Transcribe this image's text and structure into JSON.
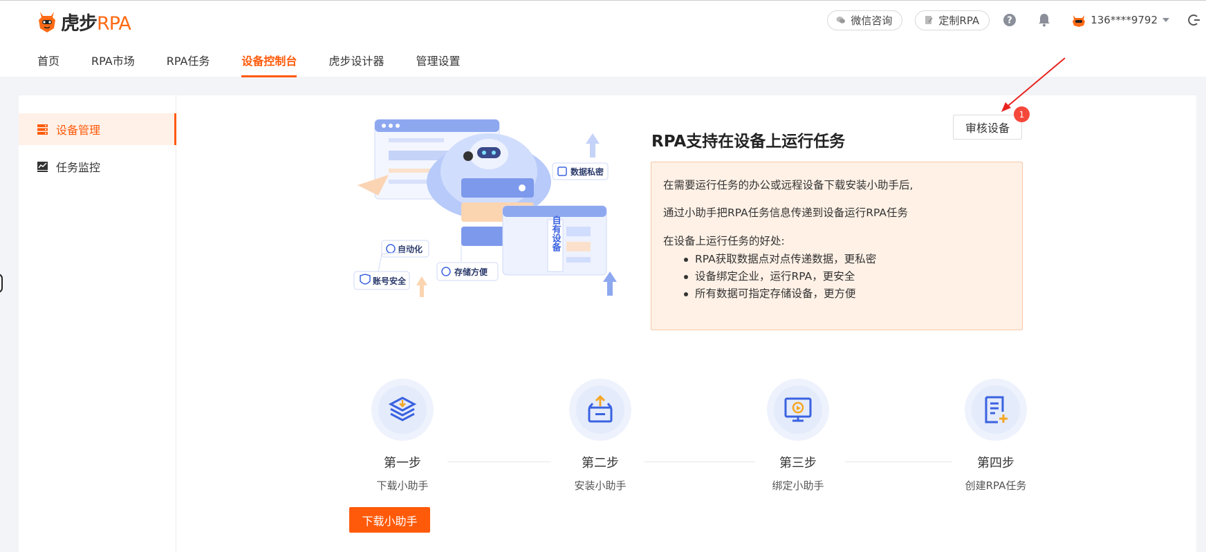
{
  "app": {
    "brand_main": "虎步",
    "brand_accent": "RPA"
  },
  "header": {
    "wechat_label": "微信咨询",
    "custom_label": "定制RPA",
    "user_name": "136****9792"
  },
  "nav": {
    "items": [
      {
        "label": "首页"
      },
      {
        "label": "RPA市场"
      },
      {
        "label": "RPA任务"
      },
      {
        "label": "设备控制台",
        "active": true
      },
      {
        "label": "虎步设计器"
      },
      {
        "label": "管理设置"
      }
    ]
  },
  "sidebar": {
    "items": [
      {
        "label": "设备管理",
        "icon": "server-icon",
        "active": true
      },
      {
        "label": "任务监控",
        "icon": "chart-icon"
      }
    ]
  },
  "main": {
    "headline": "RPA支持在设备上运行任务",
    "audit_button": "审核设备",
    "audit_badge": "1",
    "info": {
      "line1": "在需要运行任务的办公或远程设备下载安装小助手后,",
      "line2": "通过小助手把RPA任务信息传递到设备运行RPA任务",
      "benefits_title": "在设备上运行任务的好处:",
      "benefits": [
        "RPA获取数据点对点传递数据，更私密",
        "设备绑定企业，运行RPA，更安全",
        "所有数据可指定存储设备，更方便"
      ]
    },
    "illustration_labels": {
      "privacy": "数据私密",
      "automation": "自动化",
      "account": "账号安全",
      "storage": "存储方便",
      "own_device": "自有设备"
    },
    "steps": [
      {
        "title": "第一步",
        "desc": "下载小助手",
        "icon": "download-box-icon"
      },
      {
        "title": "第二步",
        "desc": "安装小助手",
        "icon": "install-box-icon"
      },
      {
        "title": "第三步",
        "desc": "绑定小助手",
        "icon": "monitor-bind-icon"
      },
      {
        "title": "第四步",
        "desc": "创建RPA任务",
        "icon": "create-task-icon"
      }
    ],
    "download_button": "下载小助手"
  },
  "colors": {
    "accent": "#ff5a0a",
    "badge": "#f5483b",
    "info_bg": "#fff1e6",
    "step_icon": "#3a62e0"
  }
}
